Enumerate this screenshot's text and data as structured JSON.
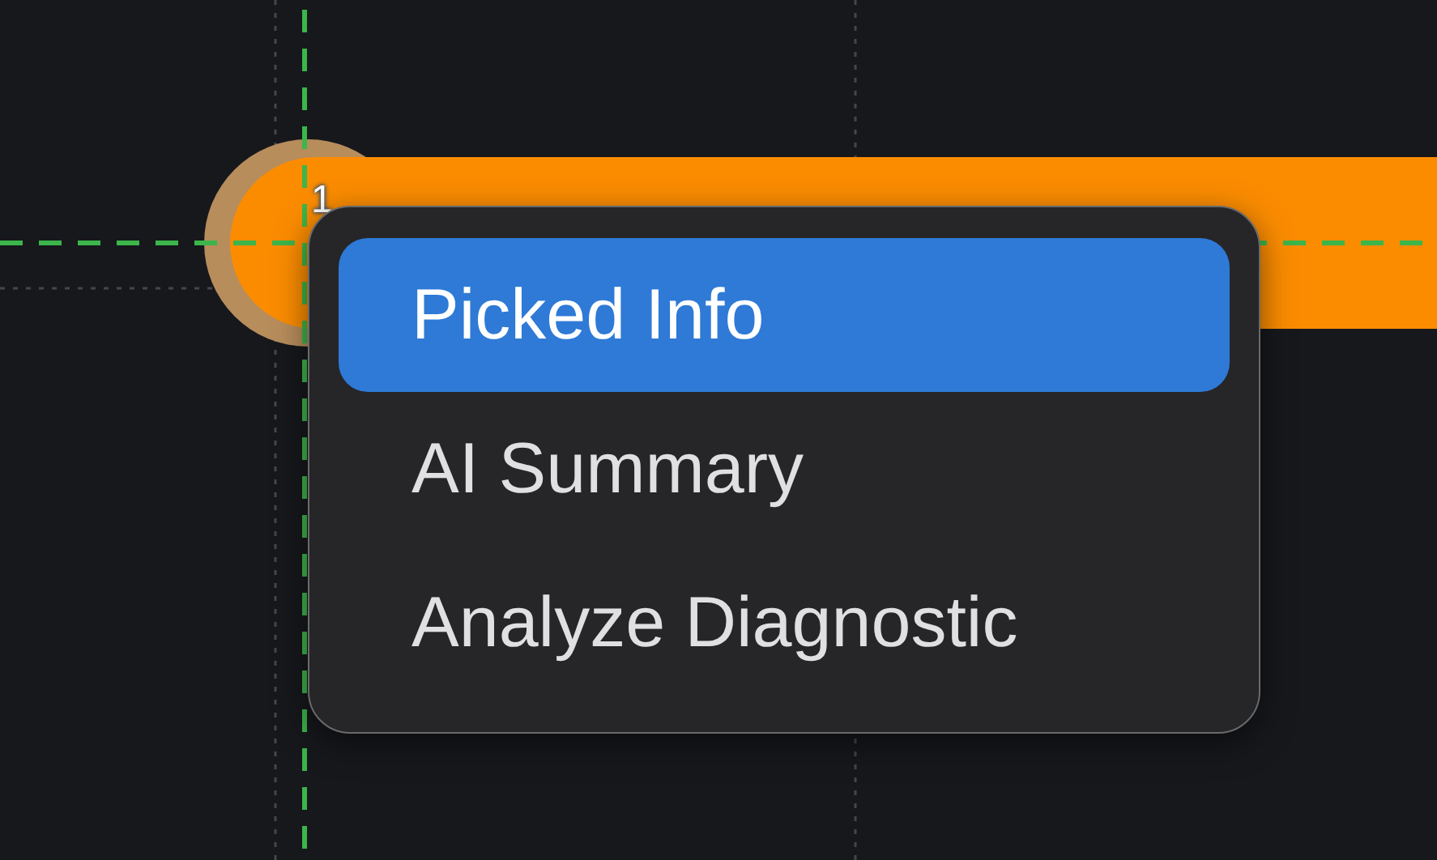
{
  "canvas": {
    "pin_label": "1"
  },
  "menu": {
    "items": [
      {
        "label": "Picked Info",
        "selected": true
      },
      {
        "label": "AI Summary",
        "selected": false
      },
      {
        "label": "Analyze Diagnostic",
        "selected": false
      }
    ]
  }
}
